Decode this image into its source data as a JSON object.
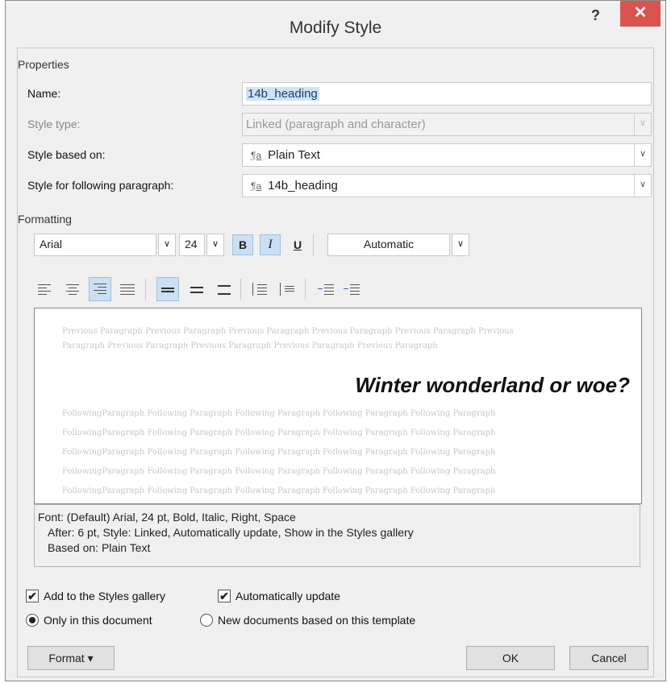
{
  "dialog": {
    "title": "Modify Style",
    "help": "?",
    "close": "✕"
  },
  "properties": {
    "section": "Properties",
    "name_label": "Name:",
    "name_value": "14b_heading",
    "style_type_label": "Style type:",
    "style_type_value": "Linked (paragraph and character)",
    "based_on_label": "Style based on:",
    "based_on_value": "Plain Text",
    "following_label": "Style for following paragraph:",
    "following_value": "14b_heading",
    "para_icon": "¶a"
  },
  "formatting": {
    "section": "Formatting",
    "font": "Arial",
    "size": "24",
    "bold": "B",
    "italic": "I",
    "underline": "U",
    "color": "Automatic",
    "dropdown_glyph": "∨"
  },
  "preview": {
    "previous": [
      "Previous Paragraph Previous Paragraph Previous Paragraph Previous Paragraph Previous Paragraph Previous",
      "Paragraph Previous Paragraph Previous Paragraph Previous Paragraph Previous Paragraph"
    ],
    "sample": "Winter wonderland or woe?",
    "following": [
      "FollowingParagraph Following Paragraph Following Paragraph Following Paragraph Following Paragraph",
      "FollowingParagraph Following Paragraph Following Paragraph Following Paragraph Following Paragraph",
      "FollowingParagraph Following Paragraph Following Paragraph Following Paragraph Following Paragraph",
      "FollowingParagraph Following Paragraph Following Paragraph Following Paragraph Following Paragraph",
      "FollowingParagraph Following Paragraph Following Paragraph Following Paragraph Following Paragraph"
    ]
  },
  "description": {
    "line1": "Font: (Default) Arial, 24 pt, Bold, Italic, Right, Space",
    "line2": "After:  6 pt, Style: Linked, Automatically update, Show in the Styles gallery",
    "line3": "Based on: Plain Text"
  },
  "options": {
    "add_gallery": "Add to the Styles gallery",
    "add_gallery_checked": true,
    "auto_update": "Automatically update",
    "auto_update_checked": true,
    "only_doc": "Only in this document",
    "new_docs": "New documents based on this template",
    "checkmark": "✔"
  },
  "buttons": {
    "format": "Format ▾",
    "ok": "OK",
    "cancel": "Cancel"
  }
}
